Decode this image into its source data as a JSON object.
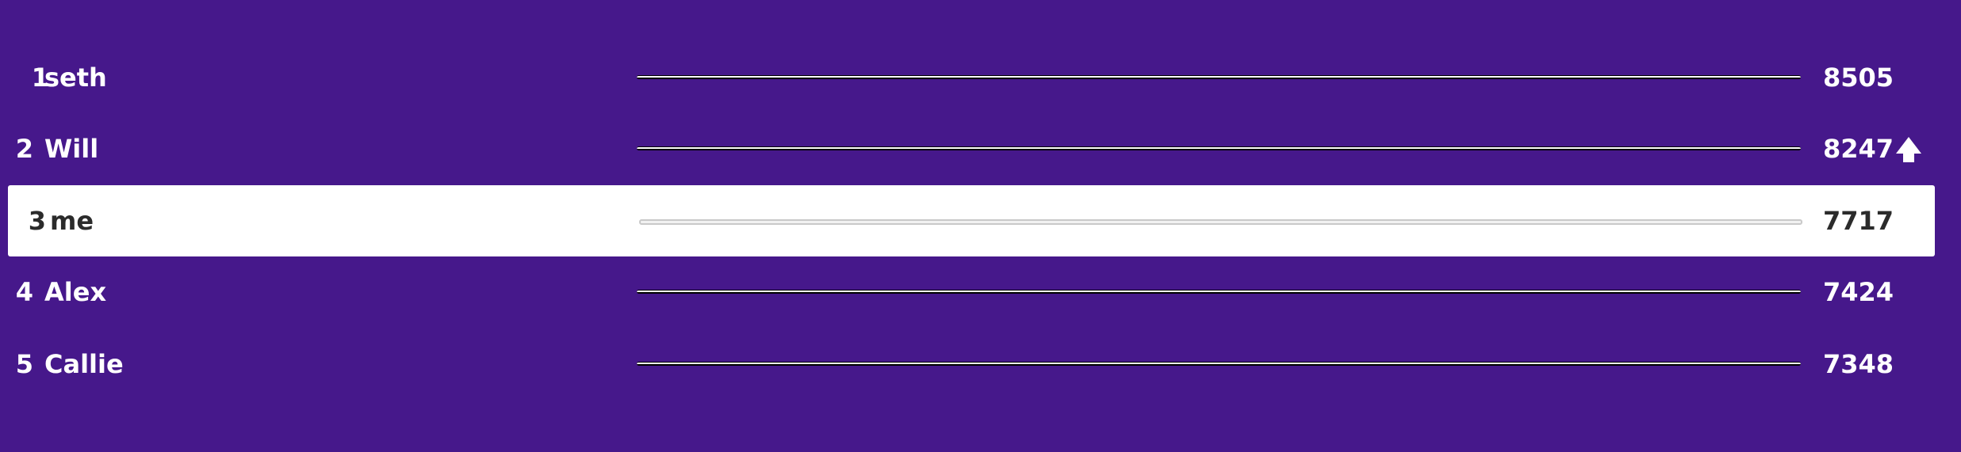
{
  "leaderboard": {
    "rows": [
      {
        "rank": "1",
        "name": "seth",
        "score": "8505"
      },
      {
        "rank": "2",
        "name": "Will",
        "score": "8247"
      },
      {
        "rank": "3",
        "name": "me",
        "score": "7717"
      },
      {
        "rank": "4",
        "name": "Alex",
        "score": "7424"
      },
      {
        "rank": "5",
        "name": "Callie",
        "score": "7348"
      }
    ],
    "highlighted_rank": "3",
    "rank_up_indicator_icon": "arrow-up-icon"
  },
  "colors": {
    "background": "#46188b",
    "highlight_background": "#ffffff",
    "text": "#ffffff",
    "highlight_text": "#2b2b2b"
  }
}
